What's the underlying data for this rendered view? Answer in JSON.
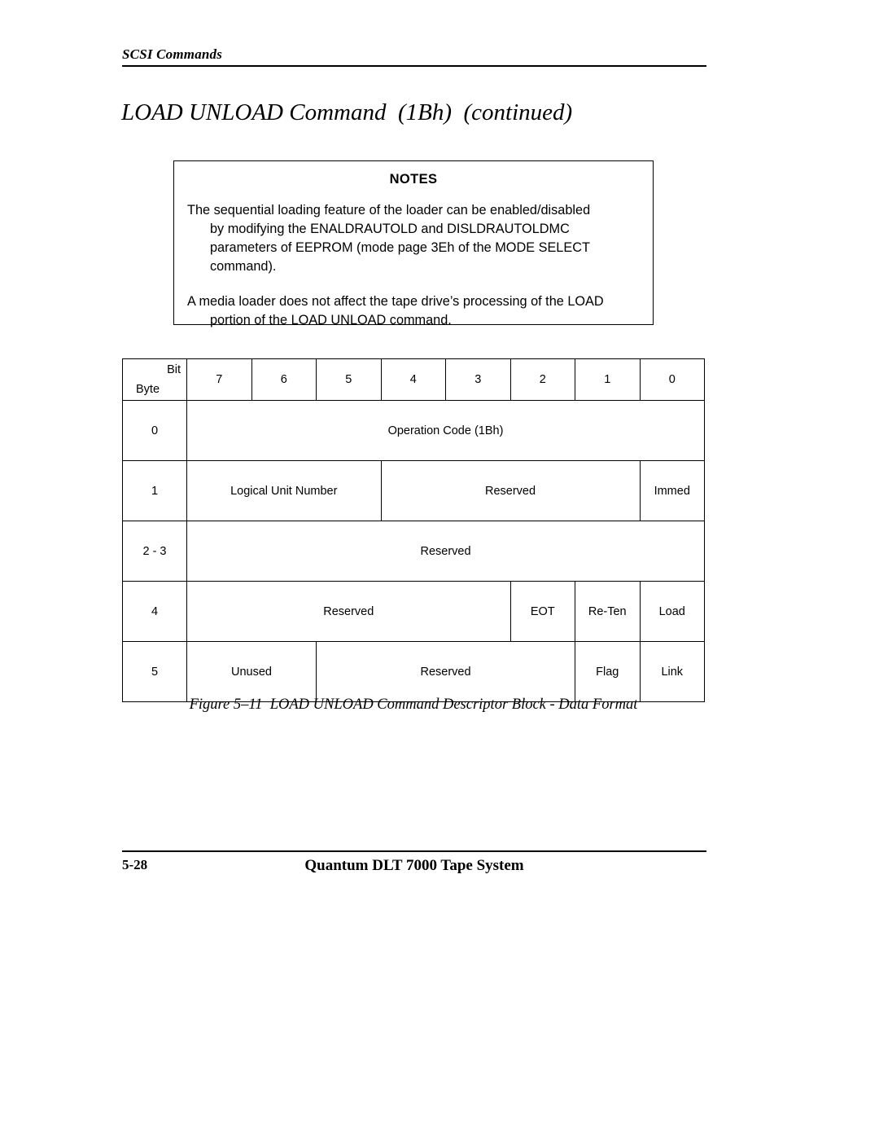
{
  "running_header": {
    "text": "SCSI Commands"
  },
  "title": "LOAD UNLOAD Command  (1Bh)  (continued)",
  "notes": {
    "heading": "NOTES",
    "paragraphs": [
      {
        "first_line": "The sequential loading feature of the loader can be enabled/disabled",
        "rest": "by modifying the ENALDRAUTOLD and DISLDRAUTOLDMC\nparameters of EEPROM (mode page 3Eh of the MODE SELECT\ncommand)."
      },
      {
        "first_line": "A media loader does not affect the tape drive’s processing of the LOAD",
        "rest": "portion of the LOAD UNLOAD command."
      }
    ]
  },
  "bit_table": {
    "corner": {
      "bit_label": "Bit",
      "byte_label": "Byte"
    },
    "bit_headers": [
      "7",
      "6",
      "5",
      "4",
      "3",
      "2",
      "1",
      "0"
    ],
    "rows": [
      {
        "byte": "0",
        "cells": [
          {
            "label": "Operation Code (1Bh)",
            "span": 8
          }
        ]
      },
      {
        "byte": "1",
        "cells": [
          {
            "label": "Logical Unit Number",
            "span": 3
          },
          {
            "label": "Reserved",
            "span": 4
          },
          {
            "label": "Immed",
            "span": 1
          }
        ]
      },
      {
        "byte": "2 - 3",
        "cells": [
          {
            "label": "Reserved",
            "span": 8
          }
        ]
      },
      {
        "byte": "4",
        "cells": [
          {
            "label": "Reserved",
            "span": 5
          },
          {
            "label": "EOT",
            "span": 1
          },
          {
            "label": "Re-Ten",
            "span": 1
          },
          {
            "label": "Load",
            "span": 1
          }
        ]
      },
      {
        "byte": "5",
        "cells": [
          {
            "label": "Unused",
            "span": 2
          },
          {
            "label": "Reserved",
            "span": 4
          },
          {
            "label": "Flag",
            "span": 1
          },
          {
            "label": "Link",
            "span": 1
          }
        ]
      }
    ]
  },
  "figure_caption": "Figure 5–11  LOAD UNLOAD Command Descriptor Block - Data Format",
  "footer": {
    "page_number": "5-28",
    "center_text": "Quantum DLT 7000 Tape System"
  }
}
